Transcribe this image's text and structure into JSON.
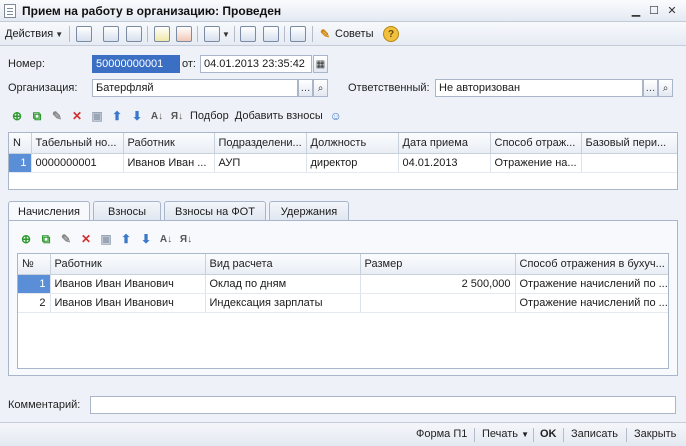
{
  "window": {
    "title": "Прием на работу в организацию: Проведен"
  },
  "toolbar": {
    "actions_label": "Действия",
    "advice_label": "Советы"
  },
  "header": {
    "number_label": "Номер:",
    "number_value": "50000000001",
    "from_label": "от:",
    "date_value": "04.01.2013 23:35:42",
    "org_label": "Организация:",
    "org_value": "Батерфляй",
    "resp_label": "Ответственный:",
    "resp_value": "Не авторизован"
  },
  "grid1_toolbar": {
    "select_label": "Подбор",
    "add_contrib_label": "Добавить взносы"
  },
  "grid1": {
    "columns": [
      "N",
      "Табельный но...",
      "Работник",
      "Подразделени...",
      "Должность",
      "Дата приема",
      "Способ отраж...",
      "Базовый пери..."
    ],
    "rows": [
      [
        "1",
        "0000000001",
        "Иванов Иван ...",
        "АУП",
        "директор",
        "04.01.2013",
        "Отражение на...",
        ""
      ]
    ]
  },
  "tabs": [
    "Начисления",
    "Взносы",
    "Взносы на ФОТ",
    "Удержания"
  ],
  "grid2": {
    "columns": [
      "№",
      "Работник",
      "Вид расчета",
      "Размер",
      "Способ отражения в бухуч..."
    ],
    "rows": [
      [
        "1",
        "Иванов Иван Иванович",
        "Оклад по дням",
        "2 500,000",
        "Отражение начислений по ..."
      ],
      [
        "2",
        "Иванов Иван Иванович",
        "Индексация зарплаты",
        "",
        "Отражение начислений по ..."
      ]
    ]
  },
  "comment": {
    "label": "Комментарий:",
    "value": ""
  },
  "footer": {
    "form_label": "Форма П1",
    "print_label": "Печать",
    "ok_label": "OK",
    "save_label": "Записать",
    "close_label": "Закрыть"
  },
  "colors": {
    "selection": "#5a8fd8",
    "add_icon": "#2e9a2e",
    "delete_icon": "#d03030",
    "arrow_icon": "#3a78c9"
  }
}
